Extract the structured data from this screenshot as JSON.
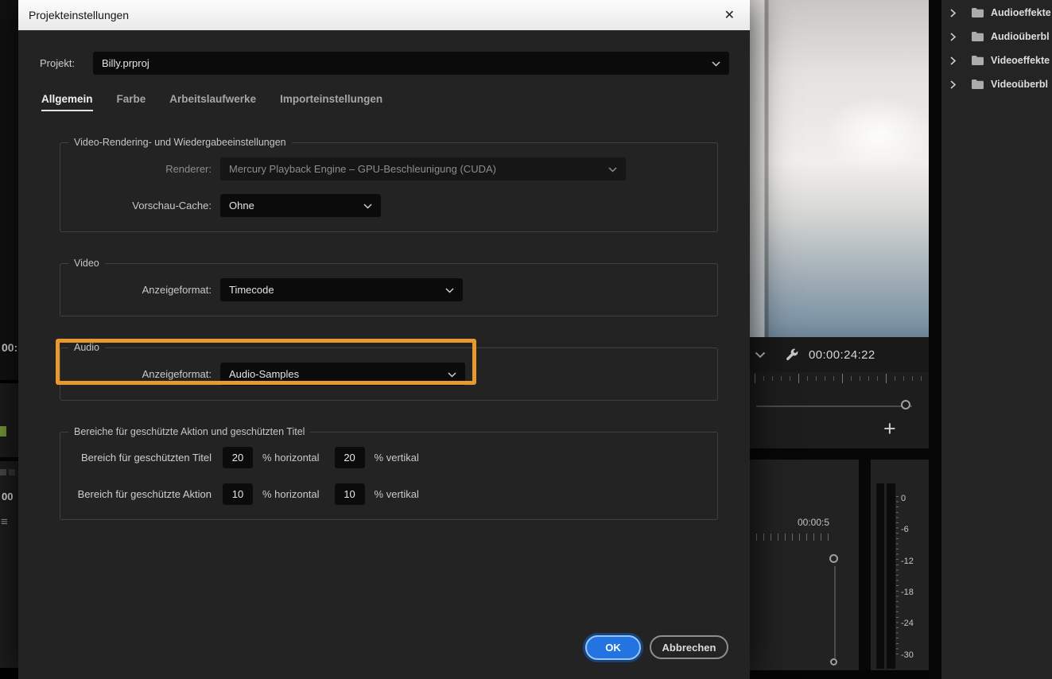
{
  "icons": {
    "close": "✕",
    "plus": "+",
    "hamburger": "≡"
  },
  "colors": {
    "highlight_orange": "#E8992E",
    "ok_button_blue": "#2374E0"
  },
  "dialog": {
    "title": "Projekteinstellungen",
    "project": {
      "label": "Projekt:",
      "value": "Billy.prproj"
    },
    "tabs": [
      {
        "label": "Allgemein",
        "active": true
      },
      {
        "label": "Farbe",
        "active": false
      },
      {
        "label": "Arbeitslaufwerke",
        "active": false
      },
      {
        "label": "Importeinstellungen",
        "active": false
      }
    ],
    "rendering": {
      "legend": "Video-Rendering- und Wiedergabeeinstellungen",
      "renderer_label": "Renderer:",
      "renderer_value": "Mercury Playback Engine – GPU-Beschleunigung (CUDA)",
      "cache_label": "Vorschau-Cache:",
      "cache_value": "Ohne"
    },
    "video": {
      "legend": "Video",
      "format_label": "Anzeigeformat:",
      "format_value": "Timecode"
    },
    "audio": {
      "legend": "Audio",
      "format_label": "Anzeigeformat:",
      "format_value": "Audio-Samples"
    },
    "safe": {
      "legend": "Bereiche für geschützte Aktion und geschützten Titel",
      "rows": [
        {
          "label": "Bereich für geschützten Titel",
          "h_value": "20",
          "h_unit": "% horizontal",
          "v_value": "20",
          "v_unit": "% vertikal"
        },
        {
          "label": "Bereich für geschützte Aktion",
          "h_value": "10",
          "h_unit": "% horizontal",
          "v_value": "10",
          "v_unit": "% vertikal"
        }
      ]
    },
    "buttons": {
      "ok": "OK",
      "cancel": "Abbrechen"
    }
  },
  "program": {
    "timecode": "00:00:24:22"
  },
  "mixer": {
    "ruler_label": "00:00:5"
  },
  "audio_meter": {
    "scale": [
      "0",
      "-6",
      "-12",
      "-18",
      "-24",
      "-30"
    ]
  },
  "bins": [
    {
      "label": "Audioeffekte"
    },
    {
      "label": "Audioüberbl"
    },
    {
      "label": "Videoeffekte"
    },
    {
      "label": "Videoüberbl"
    }
  ],
  "left_edge": {
    "timecode_fragment": "00:",
    "counter": "00"
  }
}
